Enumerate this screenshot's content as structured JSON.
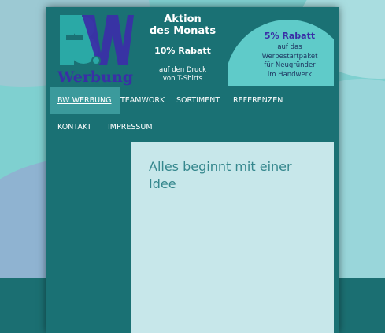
{
  "logo": {
    "letters": "BW",
    "text": "Werbung"
  },
  "aktion": {
    "title_line1": "Aktion",
    "title_line2": "des Monats",
    "rabatt": "10% Rabatt",
    "sub_line1": "auf den Druck",
    "sub_line2": "von T-Shirts"
  },
  "promo": {
    "title": "5% Rabatt",
    "line1": "auf das",
    "line2": "Werbestartpaket",
    "line3": "für Neugründer",
    "line4": "im Handwerk"
  },
  "nav": {
    "items": [
      {
        "label": "BW WERBUNG",
        "active": true
      },
      {
        "label": "TEAMWORK"
      },
      {
        "label": "SORTIMENT"
      },
      {
        "label": "REFERENZEN"
      },
      {
        "label": "KONTAKT"
      },
      {
        "label": "IMPRESSUM"
      }
    ]
  },
  "content": {
    "heading": "Alles beginnt mit einer Idee"
  },
  "colors": {
    "page": "#1a7174",
    "logo_blue": "#3a2fa6",
    "logo_teal": "#2aa9a6",
    "promo_circle": "#5fcbc9",
    "content_bg": "#c7e7ea",
    "heading": "#35878d"
  }
}
